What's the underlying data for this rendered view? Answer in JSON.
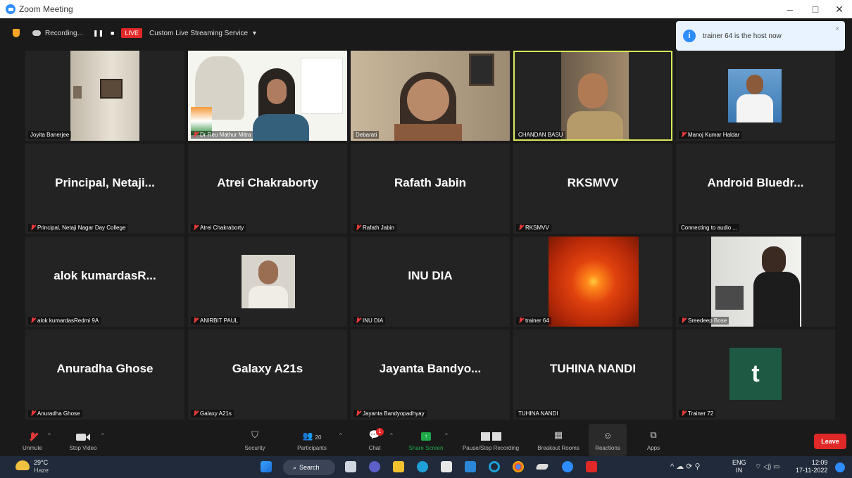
{
  "window": {
    "title": "Zoom Meeting",
    "controls": [
      "–",
      "□",
      "✕"
    ]
  },
  "topbar": {
    "recording_label": "Recording...",
    "live_badge": "LIVE",
    "streaming_service": "Custom Live Streaming Service",
    "streaming_caret": "▾"
  },
  "notification": {
    "text": "trainer 64 is the host now",
    "icon": "i",
    "close": "×"
  },
  "tiles": [
    {
      "name": "Joyita Banerjee",
      "muted": false
    },
    {
      "name": "Dr Reu Mathur Mitra",
      "muted": true
    },
    {
      "name": "Debarati",
      "muted": false
    },
    {
      "name": "CHANDAN BASU",
      "muted": false
    },
    {
      "name": "Manoj Kumar Haldar",
      "muted": true
    },
    {
      "name": "Principal, Netaji Nagar Day College",
      "display": "Principal,  Netaji...",
      "muted": true
    },
    {
      "name": "Atrei Chakraborty",
      "display": "Atrei Chakraborty",
      "muted": true
    },
    {
      "name": "Rafath Jabin",
      "display": "Rafath Jabin",
      "muted": true
    },
    {
      "name": "RKSMVV",
      "display": "RKSMVV",
      "muted": true
    },
    {
      "name": "Connecting to audio ...",
      "display": "Android  Bluedr...",
      "muted": false
    },
    {
      "name": "alok kumardasRedmi 9A",
      "display": "alok  kumardasR...",
      "muted": true
    },
    {
      "name": "ANIRBIT PAUL",
      "muted": true
    },
    {
      "name": "INU DIA",
      "display": "INU DIA",
      "muted": true
    },
    {
      "name": "trainer 64",
      "muted": true
    },
    {
      "name": "Sreedeep Bose",
      "muted": true
    },
    {
      "name": "Anuradha Ghose",
      "display": "Anuradha Ghose",
      "muted": true
    },
    {
      "name": "Galaxy A21s",
      "display": "Galaxy A21s",
      "muted": true
    },
    {
      "name": "Jayanta Bandyopadhyay",
      "display": "Jayanta  Bandyo...",
      "muted": true
    },
    {
      "name": "TUHINA NANDI",
      "display": "TUHINA NANDI",
      "muted": false
    },
    {
      "name": "Trainer 72",
      "avatar_letter": "t",
      "muted": true
    }
  ],
  "toolbar": {
    "unmute": "Unmute",
    "stop_video": "Stop Video",
    "security": "Security",
    "participants": "Participants",
    "participants_count": "20",
    "chat": "Chat",
    "chat_badge": "1",
    "share_screen": "Share Screen",
    "recording": "Pause/Stop Recording",
    "breakout": "Breakout Rooms",
    "reactions": "Reactions",
    "apps": "Apps",
    "leave": "Leave"
  },
  "taskbar": {
    "temp": "29°C",
    "weather": "Haze",
    "search": "Search",
    "lang1": "ENG",
    "lang2": "IN",
    "time": "12:09",
    "date": "17-11-2022"
  },
  "colors": {
    "accent": "#2d8cff",
    "live": "#e02828",
    "active_speaker": "#d9e85a",
    "share": "#1fa94a",
    "avatar_bg": "#1e5a43"
  }
}
